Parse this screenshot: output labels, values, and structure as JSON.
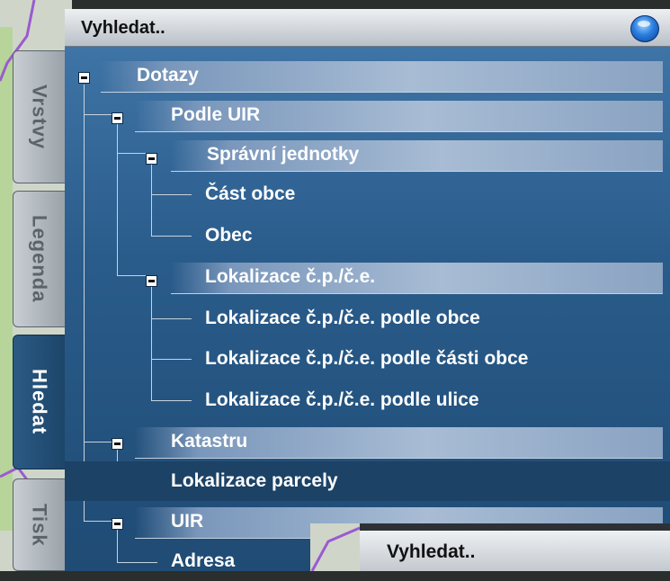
{
  "header": {
    "title": "Vyhledat..",
    "orb_icon": "info-orb-icon"
  },
  "tabs": [
    {
      "label": "Vrstvy",
      "active": false
    },
    {
      "label": "Legenda",
      "active": false
    },
    {
      "label": "Hledat",
      "active": true
    },
    {
      "label": "Tisk",
      "active": false
    }
  ],
  "tree": {
    "dotazy": "Dotazy",
    "podle_uir": "Podle UIR",
    "spravni_jednotky": "Správní jednotky",
    "cast_obce": "Část obce",
    "obec": "Obec",
    "lokalizace_cp": "Lokalizace č.p./č.e.",
    "lok_obce": "Lokalizace č.p./č.e. podle obce",
    "lok_casti": "Lokalizace č.p./č.e. podle části obce",
    "lok_ulice": "Lokalizace č.p./č.e. podle ulice",
    "katastru": "Katastru",
    "lok_parcely": "Lokalizace parcely",
    "uir": "UIR",
    "adresa": "Adresa"
  },
  "overlay": {
    "title": "Vyhledat.."
  },
  "colors": {
    "panel": "#2a5c8b",
    "selected_row": "#1c4266",
    "header": "#dfe3e7"
  }
}
